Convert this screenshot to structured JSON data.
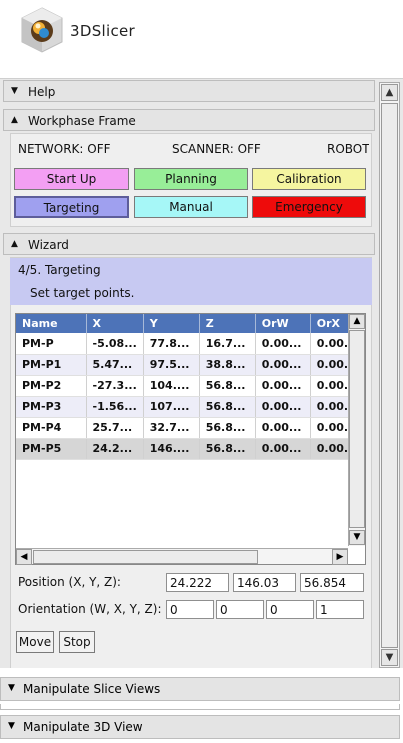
{
  "app": {
    "title": "3DSlicer"
  },
  "sections": {
    "help": {
      "label": "Help",
      "arrow": "▼"
    },
    "workphase": {
      "label": "Workphase Frame",
      "arrow": "▲"
    },
    "wizard": {
      "label": "Wizard",
      "arrow": "▲"
    },
    "slice_views": {
      "label": "Manipulate Slice Views",
      "arrow": "▼"
    },
    "view3d": {
      "label": "Manipulate 3D View",
      "arrow": "▼"
    }
  },
  "status": {
    "network": "NETWORK: OFF",
    "scanner": "SCANNER: OFF",
    "robot": "ROBOT"
  },
  "workphase_buttons": [
    {
      "label": "Start Up",
      "color": "#f39ff3"
    },
    {
      "label": "Planning",
      "color": "#98ee98"
    },
    {
      "label": "Calibration",
      "color": "#f5f5a0"
    },
    {
      "label": "Targeting",
      "color": "#9fa0ef"
    },
    {
      "label": "Manual",
      "color": "#a6f7f7"
    },
    {
      "label": "Emergency",
      "color": "#ee0b0b"
    }
  ],
  "wizard": {
    "step": "4/5. Targeting",
    "description": "Set target points."
  },
  "table": {
    "headers": [
      "Name",
      "X",
      "Y",
      "Z",
      "OrW",
      "OrX"
    ],
    "rows": [
      [
        "PM-P",
        "-5.08...",
        "77.8...",
        "16.7...",
        "0.00...",
        "0.00..."
      ],
      [
        "PM-P1",
        "5.47...",
        "97.5...",
        "38.8...",
        "0.00...",
        "0.00..."
      ],
      [
        "PM-P2",
        "-27.3...",
        "104....",
        "56.8...",
        "0.00...",
        "0.00..."
      ],
      [
        "PM-P3",
        "-1.56...",
        "107....",
        "56.8...",
        "0.00...",
        "0.00..."
      ],
      [
        "PM-P4",
        "25.7...",
        "32.7...",
        "56.8...",
        "0.00...",
        "0.00..."
      ],
      [
        "PM-P5",
        "24.2...",
        "146....",
        "56.8...",
        "0.00...",
        "0.00..."
      ]
    ]
  },
  "position": {
    "label": "Position (X, Y, Z):",
    "values": [
      "24.222",
      "146.03",
      "56.854"
    ]
  },
  "orientation": {
    "label": "Orientation (W, X, Y, Z):",
    "values": [
      "0",
      "0",
      "0",
      "1"
    ]
  },
  "actions": {
    "move": "Move",
    "stop": "Stop"
  }
}
